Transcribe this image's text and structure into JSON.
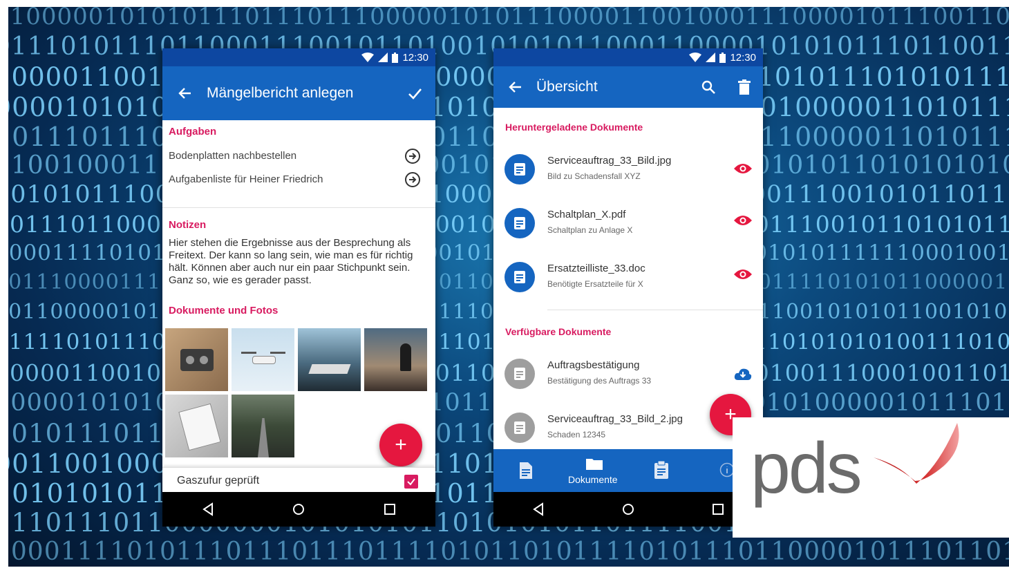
{
  "colors": {
    "primary": "#1565c0",
    "accent": "#d81b60",
    "fab": "#e5173f"
  },
  "background": {
    "rows": [
      "11000001010101110111011100000101011100001100100011100001011100110101011000011100100011110100110101",
      "011101011101100011100101101001010101100011000010101011101100110110110010101011101101010000110001",
      "100001100100111011000110110000011001111011010101011101010111001011100010110111101100001010101001011",
      "000010101010110101011001110100010111001011100100000110101111001010010010000101011101100111111110101",
      "101110111011010110101001001100100100011011101100000110101110101010111110110010101010100111010011",
      "110010001111001101001011100010101010100111001101010110101010101000010101001010011011010100011101",
      "101010111001000110101100101100001010110101010100011100101011011110001110010100011010111011000111",
      "1011101100001101011010100101100100100110101001100101110010110101011110010101001001110001011010110",
      "100011110101010010101011101101001011001010110111101010101011111100010010101101110000101101101000",
      "1011100001110101110100101101000101101000101101110001101011110101011000001000011011011100110110110",
      "101100000101010111010010110111011110100111010111101010111001010101100101000111101101011011101110",
      "111110101110010101011000101101111010110101010101011001101010101001110100001110001011101011000110",
      "100001100101010101011101011100110101011110101111000100111000100110101010010110101100101001111010",
      "000001010101111010100001010101110011100011011010101000001011101011110101110000100010101001011101",
      "101011101111011001011010110110000101111001011110100110101011111010110111001101011110010100101101",
      "001100100011010011101001011011010101101101010101001111101001011000111100010101011000011001010100",
      "101010101101001101010111010110111011011100000101011011101101011101010101101100100010101010101110",
      "111011101100000001010101011010101011011110011010111101110000011010101010001101011001110001011011",
      "1000111101011101110111011110101101011110101110110000101110110100011011110101101011010100011010100"
    ]
  },
  "phone1": {
    "status": {
      "time": "12:30",
      "wifi_icon": "wifi-icon",
      "signal_icon": "signal-icon",
      "battery_icon": "battery-icon"
    },
    "appbar": {
      "title": "Mängelbericht anlegen",
      "back_icon": "arrow-left-icon",
      "confirm_icon": "check-icon"
    },
    "tasks": {
      "heading": "Aufgaben",
      "items": [
        {
          "label": "Bodenplatten nachbestellen",
          "icon": "arrow-circle-right-icon"
        },
        {
          "label": "Aufgabenliste für Heiner Friedrich",
          "icon": "arrow-circle-right-icon"
        }
      ]
    },
    "notes": {
      "heading": "Notizen",
      "text": "Hier stehen die Ergebnisse aus der Besprechung als Freitext. Der kann so lang sein, wie man es für richtig hält. Können aber auch nur ein paar Stichpunkt sein. Ganz so, wie es gerader passt."
    },
    "docs": {
      "heading": "Dokumente und Fotos",
      "photos": [
        "cassette-recorder",
        "drone",
        "desk-window",
        "person-city",
        "newspaper",
        "road"
      ]
    },
    "fab_label": "+",
    "checkbox": {
      "label": "Gaszufur geprüft",
      "checked": true
    }
  },
  "phone2": {
    "status": {
      "time": "12:30"
    },
    "appbar": {
      "title": "Übersicht",
      "back_icon": "arrow-left-icon",
      "search_icon": "search-icon",
      "delete_icon": "trash-icon"
    },
    "downloaded": {
      "heading": "Heruntergeladene Dokumente",
      "items": [
        {
          "title": "Serviceauftrag_33_Bild.jpg",
          "subtitle": "Bild zu Schadensfall XYZ"
        },
        {
          "title": "Schaltplan_X.pdf",
          "subtitle": "Schaltplan zu Anlage X"
        },
        {
          "title": "Ersatzteilliste_33.doc",
          "subtitle": "Benötigte Ersatzteile für X"
        }
      ]
    },
    "available": {
      "heading": "Verfügbare Dokumente",
      "items": [
        {
          "title": "Auftragsbestätigung",
          "subtitle": "Bestätigung des Auftrags 33"
        },
        {
          "title": "Serviceauftrag_33_Bild_2.jpg",
          "subtitle": "Schaden 12345"
        }
      ]
    },
    "fab_label": "+",
    "bottom_nav": {
      "active_label": "Dokumente"
    }
  },
  "logo": {
    "text": "pds"
  }
}
